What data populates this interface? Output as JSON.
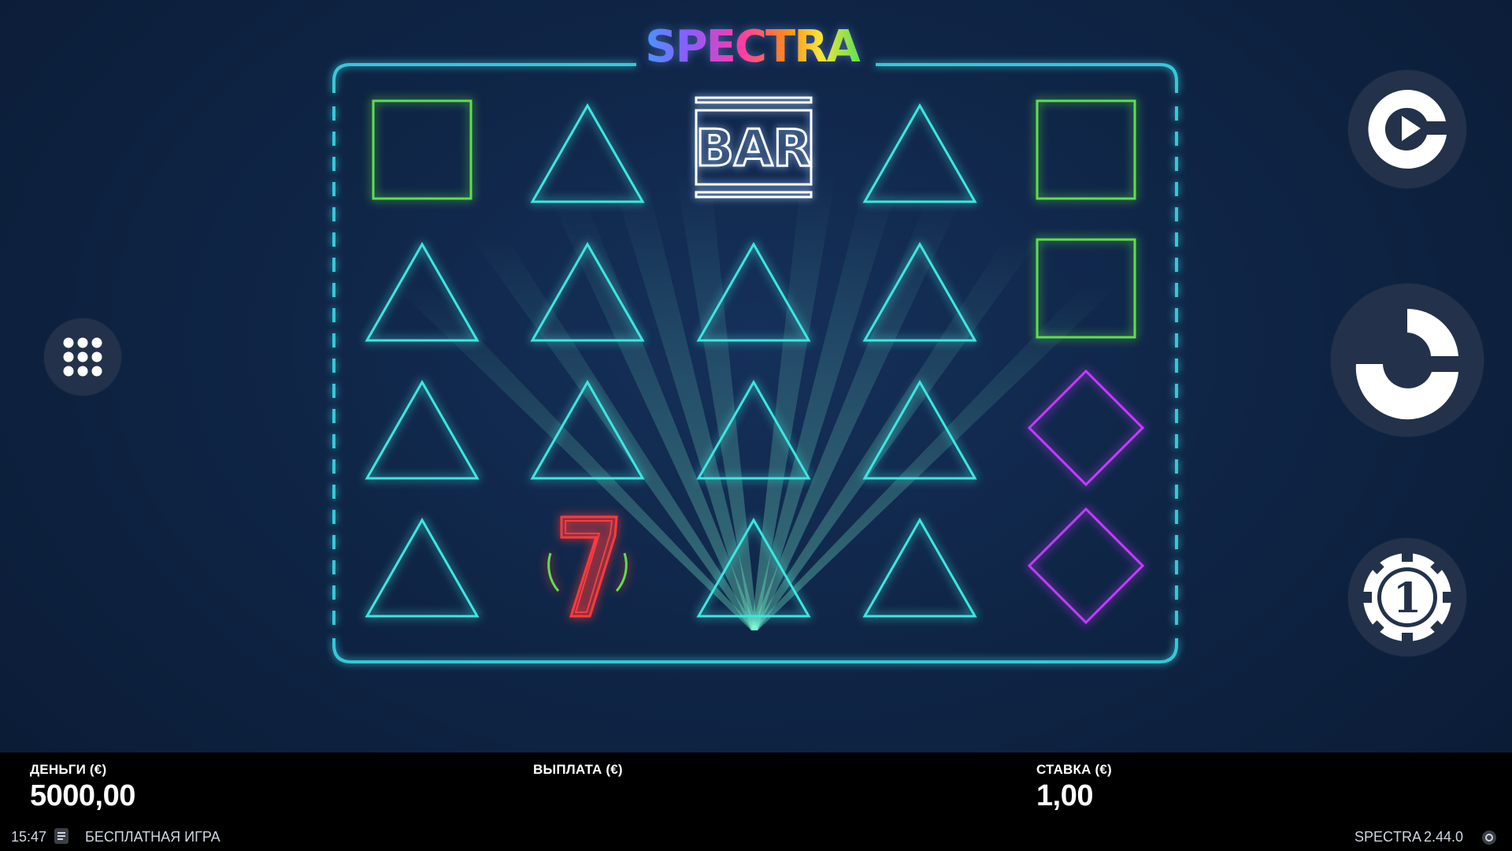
{
  "game": {
    "logo": "SPECTRA",
    "grid": [
      [
        "green-square",
        "cyan-triangle",
        "cyan-triangle",
        "cyan-triangle"
      ],
      [
        "cyan-triangle",
        "cyan-triangle",
        "cyan-triangle",
        "red-seven"
      ],
      [
        "bar",
        "cyan-triangle",
        "cyan-triangle",
        "cyan-triangle"
      ],
      [
        "cyan-triangle",
        "cyan-triangle",
        "cyan-triangle",
        "cyan-triangle"
      ],
      [
        "green-square",
        "green-square",
        "purple-diamond",
        "purple-diamond"
      ]
    ],
    "bar_text": "BAR",
    "seven_text": "7"
  },
  "controls": {
    "menu_icon": "grid-dots-icon",
    "autoplay_icon": "autoplay-icon",
    "spin_icon": "spin-icon",
    "bet_icon": "coin-bet-icon",
    "bet_chip_value": "1"
  },
  "meters": {
    "balance": {
      "label": "ДЕНЬГИ (€)",
      "value": "5000,00"
    },
    "win": {
      "label": "ВЫПЛАТА (€)",
      "value": ""
    },
    "bet": {
      "label": "СТАВКА (€)",
      "value": "1,00"
    }
  },
  "footer": {
    "time": "15:47",
    "mode": "БЕСПЛАТНАЯ ИГРА",
    "game_name": "SPECTRA",
    "version": "2.44.0",
    "history_icon": "history-icon",
    "settings_icon": "settings-icon"
  },
  "colors": {
    "cyan": "#3ee6e0",
    "green": "#5fe04a",
    "purple": "#c23cff",
    "red": "#ff3b3b",
    "frame": "#36c8d8",
    "button": "#23324a"
  }
}
